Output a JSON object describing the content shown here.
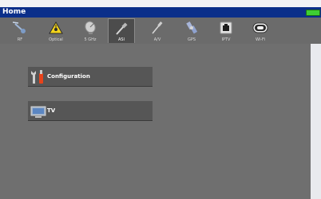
{
  "window": {
    "title": "Home"
  },
  "tabs": [
    {
      "label": "RF",
      "icon": "antenna-icon",
      "active": false
    },
    {
      "label": "Optical",
      "icon": "laser-warning-icon",
      "active": false
    },
    {
      "label": "5 GHz",
      "icon": "satellite-dish-icon",
      "active": false
    },
    {
      "label": "ASI",
      "icon": "asi-cable-icon",
      "active": true
    },
    {
      "label": "A/V",
      "icon": "av-cable-icon",
      "active": false
    },
    {
      "label": "GPS",
      "icon": "gps-satellite-icon",
      "active": false
    },
    {
      "label": "IPTV",
      "icon": "ethernet-port-icon",
      "active": false
    },
    {
      "label": "Wi-Fi",
      "icon": "wifi-icon",
      "active": false
    }
  ],
  "menu": [
    {
      "label": "Configuration",
      "icon": "tools-icon"
    },
    {
      "label": "TV",
      "icon": "tv-icon"
    }
  ],
  "colors": {
    "titlebar": "#0b2f8a",
    "tabs_bg": "#6b6b6b",
    "content_bg": "#6f6f6f",
    "button_bg": "#565656",
    "battery": "#3ecf33"
  }
}
